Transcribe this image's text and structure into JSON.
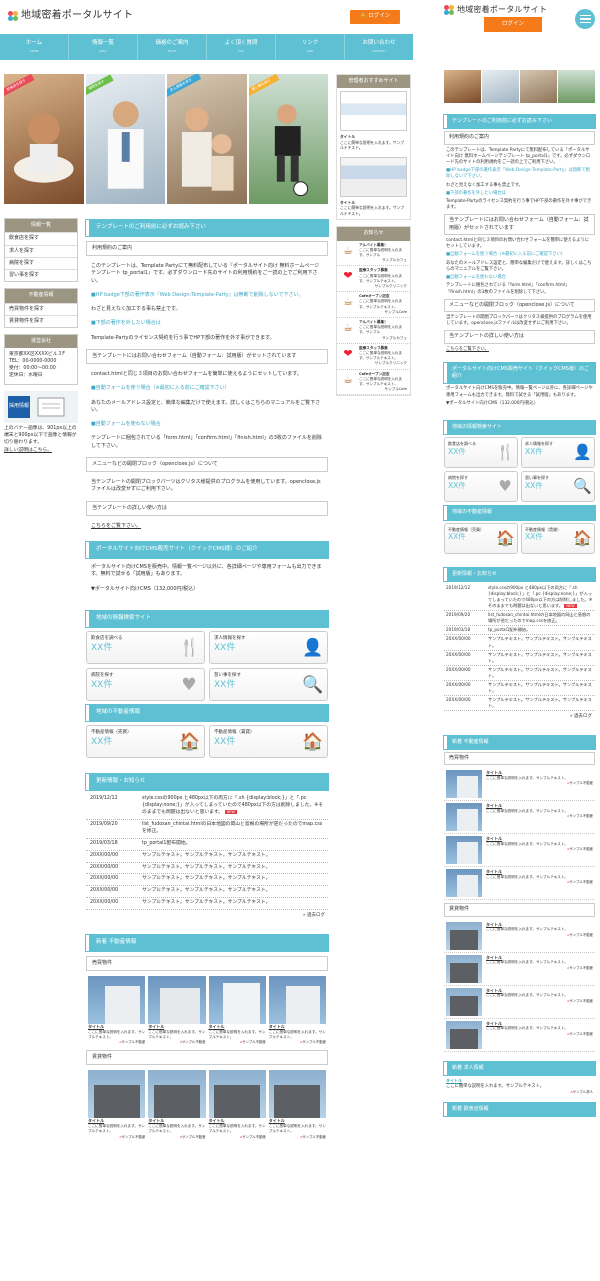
{
  "site": {
    "title": "地域密着ポータルサイト",
    "login": "ログイン"
  },
  "nav": [
    {
      "label": "ホーム",
      "sub": "HOME"
    },
    {
      "label": "情報一覧",
      "sub": "INFO"
    },
    {
      "label": "価格のご案内",
      "sub": "PRICE"
    },
    {
      "label": "よく頂く質問",
      "sub": "FAQ"
    },
    {
      "label": "リンク",
      "sub": "LINK"
    },
    {
      "label": "お問い合わせ",
      "sub": "CONTACT"
    }
  ],
  "hero_tags": [
    "飲食店を探す",
    "病院を探す",
    "求人情報を探す",
    "習い事を探す"
  ],
  "side": {
    "recommend_title": "管理者おすすめサイト",
    "recommend": [
      {
        "title": "タイトル",
        "desc": "ここに簡単な説明を入れます。サンプルテキスト。"
      },
      {
        "title": "タイトル",
        "desc": "ここに簡単な説明を入れます。サンプルテキスト。"
      }
    ],
    "notice_title": "お知らせ",
    "notices": [
      {
        "icon": "☕",
        "title": "アルバイト募集！",
        "desc": "ここに簡単な説明を入れます。サンプル",
        "foot": "サンプルカフェ"
      },
      {
        "icon": "❤",
        "title": "医療スタッフ募集",
        "desc": "ここに簡単な説明を入れます。サンプルテキスト。",
        "foot": "サンプルクリニック"
      },
      {
        "icon": "☕",
        "title": "Cafeオープン記念",
        "desc": "ここに簡単な説明を入れます。サンプルテキスト。",
        "foot": "サンプルCafe"
      },
      {
        "icon": "☕",
        "title": "アルバイト募集！",
        "desc": "ここに簡単な説明を入れます。サンプル",
        "foot": "サンプルカフェ"
      },
      {
        "icon": "❤",
        "title": "医療スタッフ募集",
        "desc": "ここに簡単な説明を入れます。サンプルテキスト。",
        "foot": "サンプルクリニック"
      },
      {
        "icon": "☕",
        "title": "Cafeオープン記念",
        "desc": "ここに簡単な説明を入れます。サンプルテキスト。",
        "foot": "サンプルCafe"
      }
    ]
  },
  "left": {
    "info_title": "情報一覧",
    "info_items": [
      "飲食店を探す",
      "求人を探す",
      "病院を探す",
      "習い事を探す"
    ],
    "estate_title": "不動産情報",
    "estate_items": [
      "売買物件を探す",
      "賃貸物件を探す"
    ],
    "company_title": "運営会社",
    "company_addr": "東京都XX区XXXXビル３F",
    "company_tel": "TEL：00-0000-0000",
    "company_hours": "受付：00:00〜00:00",
    "company_holiday": "定休日：水曜日",
    "banner_tag": "採用情報",
    "banner_note": "上のバナー画像は、901px以上の端末と900px以下で画像と情報が切り替わります。",
    "banner_link": "詳しい説明はこちら。"
  },
  "content": {
    "h_template": "テンプレートのご利用前に必ずお読み下さい",
    "h_terms": "利用規約のご案内",
    "p_terms": "このテンプレートは、Template Partyにて無料配布している『ポータルサイト向け 無料ホームページテンプレート tp_portal1』です。必ずダウンロード先のサイトの利用規約をご一読の上でご利用下さい。",
    "p_hp_title": "■HP badge下部の著作表示『Web Design:Template-Party』は無断で削除しないで下さい。",
    "p_hp_note": "わざと見えなく加工する事も禁止です。",
    "p_remove_title": "■下部の著作を外したい場合は",
    "p_remove_note": "Template-Partyのライセンス契約を行う事でHP下部の著作を外す事ができます。",
    "h_form": "当テンプレートにはお問い合わせフォーム（自動フォーム：試用版）がセットされています",
    "p_form": "contact.htmlと同じ３項目のお問い合わせフォームを簡単に使えるようにセットしています。",
    "p_auto_title": "■自動フォームを使う場合（※最初に入る前にご確認下さい）",
    "p_auto": "あなたのメールアドレス設定と、簡単な編集だけで使えます。詳しくはこちらのマニュアルをご覧下さい。",
    "p_noauto_title": "■自動フォームを使わない場合",
    "p_noauto": "テンプレートに梱包されている「form.html」「confirm.html」「finish.html」の3枚のファイルを削除して下さい。",
    "h_menu": "メニューなどの開閉ブロック（openclose.js）について",
    "p_menu": "当テンプレートの開閉ブロックパーツはクリタス様提供のプログラムを使用しています。openclose.jsファイルは改変せずにご利用下さい。",
    "h_howto": "当テンプレートの詳しい使い方は",
    "p_howto": "こちらをご覧下さい。",
    "h_cms": "ポータルサイト向けCMS販売サイト（クイックCMS様）のご紹介",
    "p_cms": "ポータルサイト向けCMSを販売中。情報一覧ページ以外に、各詳細ページや専用フォームも出力できます。無料で試せる「試用版」もあります。",
    "p_cms_price": "▼ポータルサイト向けCMS（132,000円/税込）",
    "h_search": "地域の情報検索サイト",
    "search_cards": [
      {
        "title": "飲食店を調べる",
        "value": "XX件",
        "icon": "🍴"
      },
      {
        "title": "求人情報を探す",
        "value": "XX件",
        "icon": "👤"
      },
      {
        "title": "病院を探す",
        "value": "XX件",
        "icon": "♥"
      },
      {
        "title": "習い事を探す",
        "value": "XX件",
        "icon": "🔍"
      }
    ],
    "h_estate": "地域の不動産情報",
    "estate_cards": [
      {
        "title": "不動産情報（売買）",
        "value": "XX件",
        "icon": "🏠"
      },
      {
        "title": "不動産情報（賃貸）",
        "value": "XX件",
        "icon": "🏠"
      }
    ],
    "h_news": "更新情報・お知らせ",
    "news": [
      {
        "date": "2019/12/12",
        "text": "style.cssの900px と480px以下の両方に「.sh {display:block;}」と「.pc {display:none;}」が入ってしまっていたので480px以下の方は削除しました。※そのままでも問題は出ないと思います。",
        "new": "NEW"
      },
      {
        "date": "2019/09/20",
        "text": "list_fudosan_chintai.htmlの日本地図の岡山と島根の場所が逆だったのでmap.cssを修正。",
        "new": ""
      },
      {
        "date": "2019/03/18",
        "text": "tp_portal1配布開始。",
        "new": ""
      },
      {
        "date": "20XX/00/00",
        "text": "サンプルテキスト。サンプルテキスト。サンプルテキスト。",
        "new": ""
      },
      {
        "date": "20XX/00/00",
        "text": "サンプルテキスト。サンプルテキスト。サンプルテキスト。",
        "new": ""
      },
      {
        "date": "20XX/00/00",
        "text": "サンプルテキスト。サンプルテキスト。サンプルテキスト。",
        "new": ""
      },
      {
        "date": "20XX/00/00",
        "text": "サンプルテキスト。サンプルテキスト。サンプルテキスト。",
        "new": ""
      },
      {
        "date": "20XX/00/00",
        "text": "サンプルテキスト。サンプルテキスト。サンプルテキスト。",
        "new": ""
      }
    ],
    "news_more": "» 過去ログ",
    "h_newprop": "新着 不動産情報",
    "h_sale": "売買物件",
    "h_rent": "賃貸物件",
    "prop": {
      "title": "タイトル",
      "desc": "ここに簡単な説明を入れます。サンプルテキスト。",
      "foot": "サンプル不動産"
    }
  },
  "mobile": {
    "news_more": "» 過去ログ",
    "h_newjob": "新着 求人情報",
    "job": {
      "title": "タイトル",
      "desc": "ここに簡単な説明を入れます。サンプルテキスト。",
      "foot": "サンプル求人"
    },
    "h_newfood": "新着 飲食店情報"
  }
}
